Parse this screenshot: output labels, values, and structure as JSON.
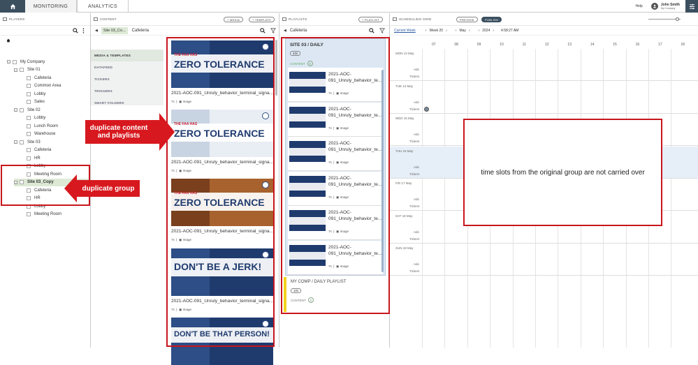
{
  "nav": {
    "tabs": [
      "MONITORING",
      "ANALYTICS"
    ],
    "help": "Help",
    "user_name": "John Smith",
    "user_company": "My Company"
  },
  "players": {
    "title": "PLAYERS",
    "tree": [
      {
        "label": "My Company",
        "level": 0,
        "toggle": "-"
      },
      {
        "label": "Site 01",
        "level": 1,
        "toggle": "-"
      },
      {
        "label": "Cafeteria",
        "level": 2
      },
      {
        "label": "Common Area",
        "level": 2
      },
      {
        "label": "Lobby",
        "level": 2
      },
      {
        "label": "Sales",
        "level": 2
      },
      {
        "label": "Site 02",
        "level": 1,
        "toggle": "-"
      },
      {
        "label": "Lobby",
        "level": 2
      },
      {
        "label": "Lunch Room",
        "level": 2
      },
      {
        "label": "Warehouse",
        "level": 2
      },
      {
        "label": "Site 03",
        "level": 1,
        "toggle": "-"
      },
      {
        "label": "Cafeteria",
        "level": 2
      },
      {
        "label": "HR",
        "level": 2
      },
      {
        "label": "Lobby",
        "level": 2
      },
      {
        "label": "Meeting Room",
        "level": 2
      },
      {
        "label": "Site 03_Copy",
        "level": 1,
        "toggle": "-",
        "selected": true
      },
      {
        "label": "Cafeteria",
        "level": 2
      },
      {
        "label": "HR",
        "level": 2
      },
      {
        "label": "Lobby",
        "level": 2
      },
      {
        "label": "Meeting Room",
        "level": 2
      }
    ]
  },
  "content": {
    "title": "CONTENT",
    "add_media": "+ MEDIA",
    "add_template": "+ TEMPLATE",
    "filter_chip": "Site 03_Co...",
    "filter_value": "Cafeteria",
    "categories": [
      "MEDIA & TEMPLATES",
      "DATAFEED",
      "TICKERS",
      "TRIGGERS",
      "SMART FOLDERS"
    ],
    "items": [
      {
        "name": "2021-AOC-091_Unruly_behavior_terminal_signa...",
        "duration": "7s",
        "type": "Image",
        "headline": "ZERO TOLERANCE",
        "kicker": "THE FAA HAS"
      },
      {
        "name": "2021-AOC-091_Unruly_behavior_terminal_signa...",
        "duration": "7s",
        "type": "Image",
        "headline": "ZERO TOLERANCE",
        "kicker": "THE FAA HAS"
      },
      {
        "name": "2021-AOC-091_Unruly_behavior_terminal_signa...",
        "duration": "7s",
        "type": "Image",
        "headline": "ZERO TOLERANCE",
        "kicker": "THE FAA HAS"
      },
      {
        "name": "2021-AOC-091_Unruly_behavior_terminal_signa...",
        "duration": "7s",
        "type": "Image",
        "headline": "DON'T BE A JERK!",
        "kicker": ""
      },
      {
        "name": "",
        "duration": "",
        "type": "",
        "headline": "DON'T BE THAT PERSON!",
        "kicker": ""
      }
    ]
  },
  "playlists": {
    "title": "PLAYLISTS",
    "add_playlist": "+ PLAYLIST",
    "filter_value": "Cafeteria",
    "current": {
      "title": "SITE 03 / DAILY",
      "duration": "42s",
      "content_label": "CONTENT",
      "content_count": "6"
    },
    "items": [
      {
        "name": "2021-AOC-091_Unruly_behavior_te...",
        "duration": "7s",
        "type": "Image"
      },
      {
        "name": "2021-AOC-091_Unruly_behavior_te...",
        "duration": "7s",
        "type": "Image"
      },
      {
        "name": "2021-AOC-091_Unruly_behavior_te...",
        "duration": "7s",
        "type": "Image"
      },
      {
        "name": "2021-AOC-091_Unruly_behavior_te...",
        "duration": "7s",
        "type": "Image"
      },
      {
        "name": "2021-AOC-091_Unruly_behavior_te...",
        "duration": "7s",
        "type": "Image"
      },
      {
        "name": "2021-AOC-091_Unruly_behavior_te...",
        "duration": "7s",
        "type": "Image"
      }
    ],
    "other": {
      "title": "MY COMP / DAILY PLAYLIST",
      "duration": "10s",
      "content_label": "CONTENT",
      "content_count": "2"
    }
  },
  "schedule": {
    "title": "SCHEDULING GRID",
    "preview": "PREVIEW",
    "publish": "PUBLISH",
    "current_week": "Current Week",
    "week": "Week 20",
    "month": "May",
    "year": "2024",
    "time": "4:58:27 AM",
    "hours": [
      "07",
      "08",
      "09",
      "10",
      "11",
      "12",
      "13",
      "14",
      "15",
      "16",
      "17",
      "18"
    ],
    "days": [
      {
        "label": "MON 13 May",
        "ads": "Ads",
        "tickers": "Tickers"
      },
      {
        "label": "TUE 14 May",
        "ads": "Ads",
        "tickers": "Tickers"
      },
      {
        "label": "WED 15 May",
        "ads": "Ads",
        "tickers": "Tickers"
      },
      {
        "label": "THU 16 May",
        "ads": "Ads",
        "tickers": "Tickers"
      },
      {
        "label": "FRI 17 May",
        "ads": "Ads",
        "tickers": "Tickers"
      },
      {
        "label": "SAT 18 May",
        "ads": "Ads",
        "tickers": "Tickers"
      },
      {
        "label": "SUN 19 May",
        "ads": "Ads",
        "tickers": "Tickers"
      }
    ]
  },
  "annotations": {
    "duplicate_content": "duplicate content\nand playlists",
    "duplicate_group": "duplicate group",
    "note": "time slots from the original group are not carried over"
  },
  "colors": {
    "nav_dark": "#3b4f5f",
    "annotation_red": "#c8161d",
    "selected_green": "#dde9d5",
    "playlist_active": "#dce7f3"
  }
}
